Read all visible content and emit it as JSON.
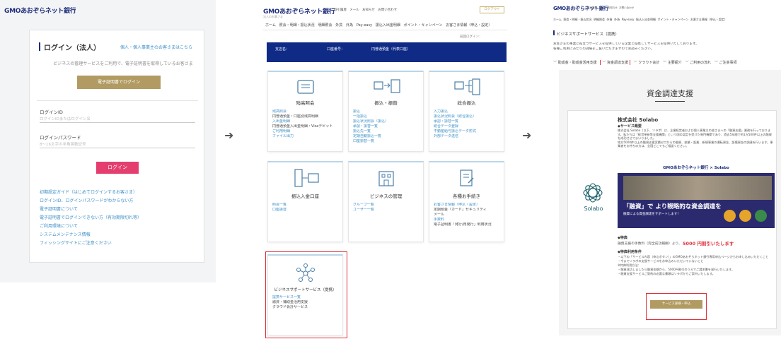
{
  "brand": {
    "name": "GMOあおぞらネット銀行"
  },
  "panel1": {
    "title": "ログイン（法人）",
    "title_link": "個人・個人事業主のお客さまはこちら",
    "desc": "ビジネスの管理サービスをご利用で、電子証明書を取得しているお客さま",
    "cert_button": "電子証明書でログイン",
    "login_id_label": "ログインID",
    "login_id_placeholder": "ログインIDまたはログイン名",
    "password_label": "ログインパスワード",
    "password_placeholder": "8〜16文字の半角英数記号",
    "login_button": "ログイン",
    "links": [
      "初期設定ガイド（はじめてログインするお客さま）",
      "ログインID、ログインパスワードがわからない方",
      "電子証明書について",
      "電子証明書でログインできない方（有効期限切れ等）",
      "ご利用環境について",
      "システムメンテナンス情報",
      "フィッシングサイトにご注意ください"
    ]
  },
  "panel2": {
    "brand_sub": "法人のお客さま",
    "header_links": [
      "取引履歴",
      "メール",
      "お知らせ",
      "お問い合わせ"
    ],
    "logout": "ログアウト",
    "nav": [
      "ホーム",
      "照会・明細・振込状況",
      "明細照会",
      "外貨",
      "外為",
      "Pay-easy",
      "振込入出金明細",
      "ポイント・キャンペーン",
      "お客さま情報（申込・設定）"
    ],
    "last_login": "前回ログイン：",
    "bar_labels": [
      "支店名：",
      "口座番号：",
      "円普通預金（代表口座）"
    ],
    "tiles": [
      {
        "title": "残高照会",
        "lines": [
          "残高照会",
          "円普通預金・口座別残高明細",
          "入出金明細",
          "円普通預金入出金明細・Visaデビット",
          "ご利用明細",
          "ファイル出力"
        ]
      },
      {
        "title": "振込・振替",
        "lines": [
          "振込",
          "一括振込",
          "振込状況照会（振込）",
          "承認・振替一覧",
          "振込先一覧",
          "定期自動振込一覧",
          "口座振替一覧"
        ]
      },
      {
        "title": "総合振込",
        "lines": [
          "入力振込",
          "振込状況照会（総合振込）",
          "承認・振替一覧",
          "総合データ登録",
          "不動産給与振込データ形式",
          "外部データ送信"
        ]
      },
      {
        "title": "振込入金口座",
        "lines": [
          "照会一覧",
          "口座振替"
        ]
      },
      {
        "title": "ビジネスの管理",
        "lines": [
          "グループ一覧",
          "ユーザー一覧"
        ]
      },
      {
        "title": "各種お手続き",
        "lines": [
          "お客さま情報（申込・設定）",
          "定期預金「カード」セキュリティ",
          "メール",
          "手数料",
          "電子証明書「発行/再発行」利用状況"
        ]
      },
      {
        "title": "ビジネスサポートサービス（提携）",
        "lines": [
          "提携サービス一覧",
          "融資・補助金活用支援",
          "クラウド会計サービス"
        ]
      }
    ]
  },
  "panel3": {
    "heading": "ビジネスサポートサービス（提携）",
    "intro": [
      "お客さまの事業に役立つサービスを提供している企業と提携してサービスを提供いたしております。",
      "各種ご利用にあたりの詳細をご覧いただきますのでお読みください。"
    ],
    "tabs": [
      "助成金・助成金活用支援",
      "資金調達支援",
      "クラウド会計",
      "主要紹介",
      "ご利用の流れ",
      "ご注意事項"
    ],
    "section_title": "資金調達支援",
    "company": "株式会社 Solabo",
    "service_label": "◆サービス概要",
    "service_text": [
      "株式会社 Solabo（以下、ソラボ）は、企業経営者および個人事業主の皆さまへの「融資支援」業務を行っております。私たちは「経営革新等支援機関」という国の認定を受けた専門機関であり、過去5年間で約1万500件以上の融資を成功させてまいりました。",
      "地方5000件以上の融資支援実績ゼロからの融資、創業・起業、新規事業の運転資金、設備資金の調達を行います。事業者をお持ちの方は、全国どこでもご相談ください。"
    ],
    "banner_brand": "GMOあおぞらネット銀行 × Solabo",
    "banner_headline": "「融資」で より戦略的な資金調達を",
    "banner_sub": "融資による資金調達をサポートします！",
    "logo_text": "Solabo",
    "special_label": "◆特典",
    "special_text": "融資支援の手数料（完全成功報酬）より、",
    "special_highlight": "5000 円割引いたします",
    "conditions_label": "◆特典利用条件",
    "conditions": [
      "・以下の「サービス内容（申込ボタン）」のGMOあおぞらネット銀行専用申込ページからお申し込みいただくこと",
      "・今までソラボの支援サービスをお申込みいただいていないこと",
      "※特典利用方法：",
      "・融資成功しましたら融資金額から、5000円割引のうえでご請求書を発行いたします。",
      "・融資支援サービスご契約の必要な書類はソラボからご案内いたします。"
    ],
    "apply_button": "サービス詳細・申込"
  },
  "arrows": [
    "➜",
    "➜"
  ],
  "colors": {
    "navy": "#1d2d7a",
    "gold": "#b19b62",
    "pink": "#e43e6e",
    "red": "#e0303a",
    "link": "#3c8fc7"
  }
}
